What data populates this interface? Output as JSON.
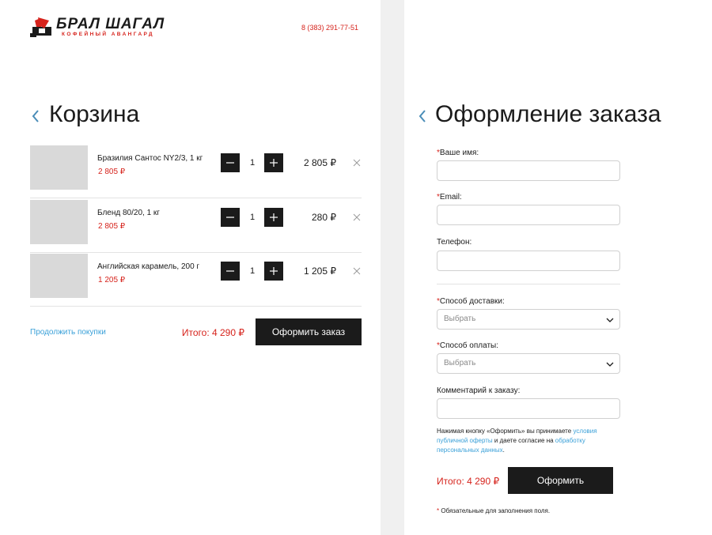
{
  "header": {
    "logo_title": "БРАЛ ШАГАЛ",
    "logo_subtitle": "КОФЕЙНЫЙ АВАНГАРД",
    "phone": "8 (383) 291-77-51"
  },
  "cart": {
    "title": "Корзина",
    "items": [
      {
        "name": "Бразилия Сантос NY2/3, 1 кг",
        "price": "2 805 ₽",
        "qty": "1",
        "total": "2 805 ₽"
      },
      {
        "name": "Бленд 80/20, 1 кг",
        "price": "2 805 ₽",
        "qty": "1",
        "total": "280 ₽"
      },
      {
        "name": "Английская карамель, 200 г",
        "price": "1 205 ₽",
        "qty": "1",
        "total": "1 205 ₽"
      }
    ],
    "continue_label": "Продолжить покупки",
    "total_label": "Итого: 4 290 ₽",
    "checkout_label": "Оформить заказ"
  },
  "order": {
    "title": "Оформление заказа",
    "required_mark": "*",
    "name_label": "Ваше имя:",
    "email_label": "Email:",
    "phone_label": "Телефон:",
    "delivery_label": "Способ доставки:",
    "delivery_value": "Выбрать",
    "payment_label": "Способ оплаты:",
    "payment_value": "Выбрать",
    "comment_label": "Комментарий к заказу:",
    "consent_text_1": "Нажимая кнопку «Оформить» вы принимаете ",
    "consent_link_1": "условия публичной оферты",
    "consent_text_2": " и даете согласие на ",
    "consent_link_2": "обработку персональных данных",
    "consent_text_3": ".",
    "total_label": "Итого: 4 290 ₽",
    "submit_label": "Оформить",
    "required_note": " Обязательные для заполнения поля."
  },
  "colors": {
    "accent": "#d6231c",
    "link": "#3aa0d8",
    "dark": "#1b1b1b",
    "placeholder": "#d9d9d9"
  },
  "icons": {
    "back": "chevron-left-icon",
    "minus": "minus-icon",
    "plus": "plus-icon",
    "remove": "close-icon",
    "dropdown": "chevron-down-icon"
  }
}
